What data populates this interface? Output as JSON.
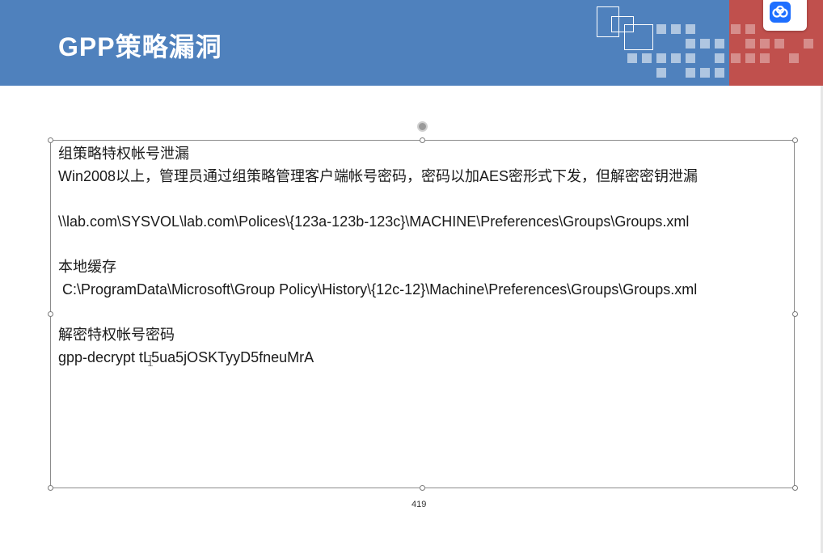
{
  "slide": {
    "title": "GPP策略漏洞",
    "page_number": "419"
  },
  "colors": {
    "header_blue": "#4f81bd",
    "header_red": "#c0504d",
    "app_badge_blue": "#1e6fff"
  },
  "textbox": {
    "lines": [
      "组策略特权帐号泄漏",
      "Win2008以上，管理员通过组策略管理客户端帐号密码，密码以加AES密形式下发，但解密密钥泄漏",
      "\\\\lab.com\\SYSVOL\\lab.com\\Polices\\{123a-123b-123c}\\MACHINE\\Preferences\\Groups\\Groups.xml",
      "本地缓存",
      " C:\\ProgramData\\Microsoft\\Group Policy\\History\\{12c-12}\\Machine\\Preferences\\Groups\\Groups.xml",
      "解密特权帐号密码",
      "gpp-decrypt tL5ua5jOSKTyyD5fneuMrA"
    ]
  },
  "icons": {
    "app_badge": "baidu-netdisk-icon",
    "rotate_handle": "rotate-handle-icon",
    "text_cursor": "i-beam-cursor-icon"
  }
}
